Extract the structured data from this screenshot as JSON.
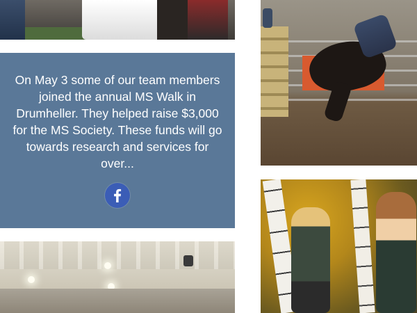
{
  "news_card": {
    "text": "On May 3 some of our team members joined the annual MS Walk in Drumheller. They helped raise $3,000 for the MS Society. These funds will go towards research and services for over...",
    "background_color": "#5a7898",
    "share_icon": "facebook-icon",
    "share_icon_color": "#3b5db6"
  },
  "tiles": {
    "top_left": "team-event-photo",
    "bottom_left": "arena-interior-photo",
    "top_right": "rodeo-bronc-photo",
    "bottom_right": "autumn-portrait-photo"
  }
}
